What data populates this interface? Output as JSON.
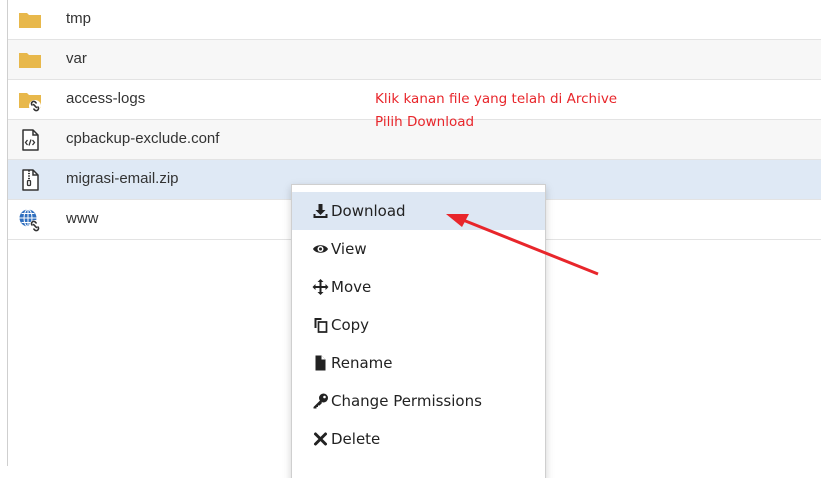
{
  "files": [
    {
      "name": "tmp",
      "icon": "folder-icon"
    },
    {
      "name": "var",
      "icon": "folder-icon"
    },
    {
      "name": "access-logs",
      "icon": "folder-link-icon"
    },
    {
      "name": "cpbackup-exclude.conf",
      "icon": "code-file-icon"
    },
    {
      "name": "migrasi-email.zip",
      "icon": "zip-file-icon",
      "selected": true
    },
    {
      "name": "www",
      "icon": "globe-link-icon"
    }
  ],
  "annotation": {
    "line1": "Klik kanan file yang telah di Archive",
    "line2": "Pilih Download"
  },
  "context_menu": {
    "items": [
      {
        "label": "Download",
        "icon": "download-icon",
        "highlighted": true
      },
      {
        "label": "View",
        "icon": "eye-icon"
      },
      {
        "label": "Move",
        "icon": "move-arrows-icon"
      },
      {
        "label": "Copy",
        "icon": "copy-icon"
      },
      {
        "label": "Rename",
        "icon": "file-icon"
      },
      {
        "label": "Change Permissions",
        "icon": "key-icon"
      },
      {
        "label": "Delete",
        "icon": "delete-x-icon"
      }
    ]
  },
  "colors": {
    "folder": "#e8b84b",
    "annotation_text": "#e8262b",
    "arrow": "#e8262b",
    "selected_row": "#dfe9f5",
    "menu_highlight": "#dde7f3",
    "globe": "#2f6fbf"
  }
}
